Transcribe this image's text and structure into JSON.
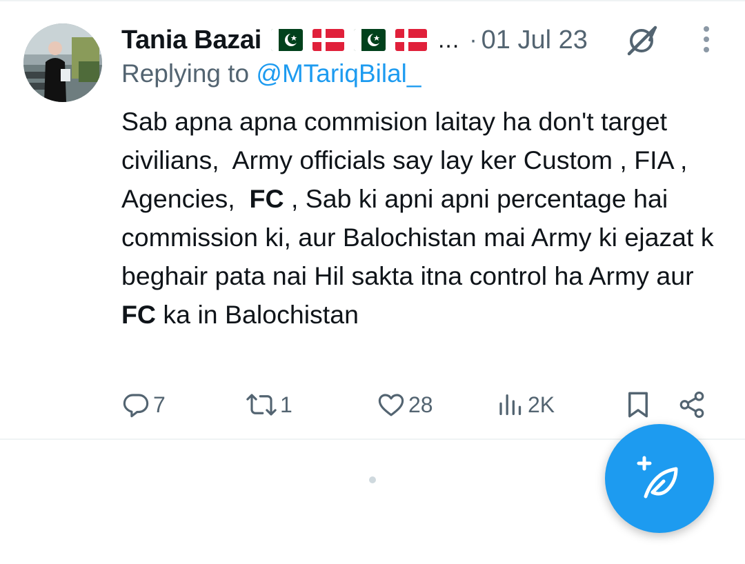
{
  "tweet": {
    "author": {
      "display_name": "Tania Bazai",
      "flags": [
        "pakistan-flag",
        "denmark-flag",
        "pakistan-flag",
        "denmark-flag"
      ],
      "name_overflow": "..."
    },
    "separator": "·",
    "date": "01 Jul 23",
    "reply": {
      "prefix": "Replying to",
      "handle": "@MTariqBilal_"
    },
    "text_segments": [
      {
        "text": "Sab apna apna commision laitay ha don't target civilians,  Army officials say lay ker Custom , FIA , Agencies,  ",
        "bold": false
      },
      {
        "text": "FC",
        "bold": true
      },
      {
        "text": " , Sab ki apni apni percentage hai commission ki, aur Balochistan mai Army ki ejazat k beghair pata nai Hil sakta itna control ha Army aur ",
        "bold": false
      },
      {
        "text": "FC",
        "bold": true
      },
      {
        "text": " ka in Balochistan",
        "bold": false
      }
    ],
    "actions": {
      "replies": "7",
      "reposts": "1",
      "likes": "28",
      "views": "2K"
    }
  },
  "icons": {
    "grok": "grok-icon",
    "more": "more-vertical-icon",
    "reply": "reply-icon",
    "repost": "repost-icon",
    "like": "heart-icon",
    "views": "views-icon",
    "bookmark": "bookmark-icon",
    "share": "share-icon",
    "compose": "compose-post-icon"
  },
  "colors": {
    "accent": "#1d9bf0",
    "secondary_text": "#536471",
    "primary_text": "#0f1419"
  }
}
